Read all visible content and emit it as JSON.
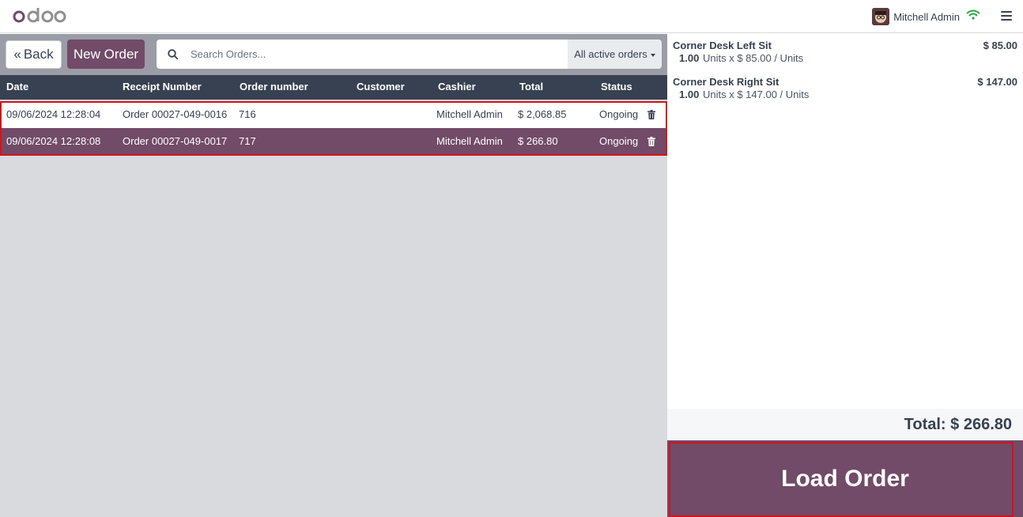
{
  "navbar": {
    "logo_text": "odoo",
    "user_name": "Mitchell Admin",
    "icons": [
      "odoo-logo",
      "avatar",
      "wifi-icon",
      "menu-icon"
    ]
  },
  "controls": {
    "back_label": "Back",
    "new_order_label": "New Order",
    "search_placeholder": "Search Orders...",
    "filter_label": "All active orders"
  },
  "table": {
    "columns": [
      "Date",
      "Receipt Number",
      "Order number",
      "Customer",
      "Cashier",
      "Total",
      "Status"
    ],
    "rows": [
      {
        "date": "09/06/2024 12:28:04",
        "receipt": "Order 00027-049-0016",
        "order_number": "716",
        "customer": "",
        "cashier": "Mitchell Admin",
        "total": "$ 2,068.85",
        "status": "Ongoing"
      },
      {
        "date": "09/06/2024 12:28:08",
        "receipt": "Order 00027-049-0017",
        "order_number": "717",
        "customer": "",
        "cashier": "Mitchell Admin",
        "total": "$ 266.80",
        "status": "Ongoing"
      }
    ]
  },
  "order_detail": {
    "lines": [
      {
        "name": "Corner Desk Left Sit",
        "price": "$ 85.00",
        "qty": "1.00",
        "detail": "Units x $ 85.00 / Units"
      },
      {
        "name": "Corner Desk Right Sit",
        "price": "$ 147.00",
        "qty": "1.00",
        "detail": "Units x $ 147.00 / Units"
      }
    ],
    "total": "Total: $ 266.80",
    "load_label": "Load Order"
  },
  "colors": {
    "primary": "#714b67",
    "header_dark": "#374151",
    "highlight": "#d4111c",
    "wifi": "#28a745"
  }
}
